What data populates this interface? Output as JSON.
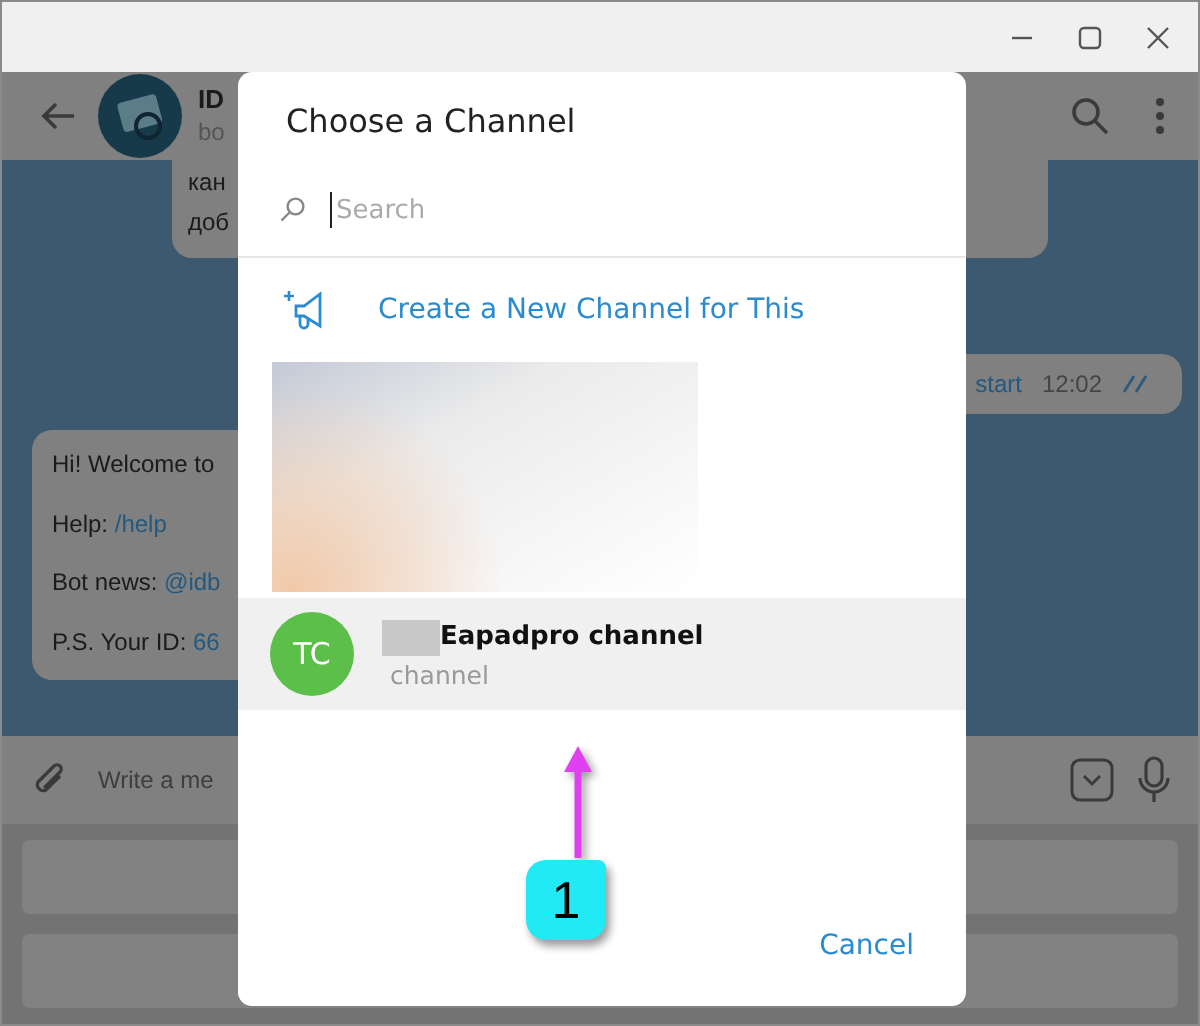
{
  "chat_header": {
    "title": "ID",
    "subtitle": "bo"
  },
  "messages": [
    {
      "kind": "incoming",
      "lines": [
        {
          "label": "кан"
        },
        {
          "label": "доб"
        }
      ]
    },
    {
      "kind": "outgoing",
      "text": "start",
      "time": "12:02"
    },
    {
      "kind": "incoming",
      "lines": [
        {
          "label": "Hi! Welcome to"
        },
        {
          "label": "Help: ",
          "link": "/help"
        },
        {
          "label": "Bot news: ",
          "link": "@idb"
        },
        {
          "label": "P.S. Your ID: ",
          "link": "66"
        }
      ]
    }
  ],
  "composer": {
    "placeholder": "Write a me"
  },
  "dialog": {
    "title": "Choose a Channel",
    "search": {
      "placeholder": "Search"
    },
    "create_action": "Create a New Channel for This",
    "channels": [
      {
        "initials": "TC",
        "name": "Eapadpro channel",
        "subtitle": "channel",
        "selected": true,
        "color": "#5cbf4a"
      }
    ],
    "buttons": [
      "Cancel"
    ]
  },
  "annotation": {
    "number": "1"
  }
}
